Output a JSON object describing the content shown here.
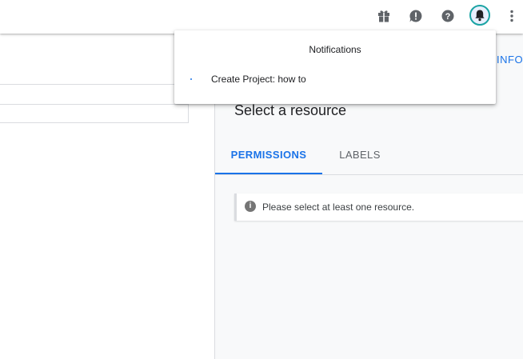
{
  "topbar": {
    "icons": [
      "gift-icon",
      "feedback-icon",
      "help-icon",
      "notifications-bell-icon",
      "more-vert-icon"
    ]
  },
  "notifications": {
    "title": "Notifications",
    "items": [
      {
        "label": "Create Project: how to"
      }
    ]
  },
  "right_panel": {
    "info_link": "INFO P",
    "title": "Select a resource",
    "tabs": [
      {
        "label": "PERMISSIONS",
        "active": true
      },
      {
        "label": "LABELS",
        "active": false
      }
    ],
    "message": "Please select at least one resource."
  },
  "colors": {
    "accent": "#1a73e8",
    "bell_ring": "#1aa3a3",
    "info_icon": "#757575"
  }
}
